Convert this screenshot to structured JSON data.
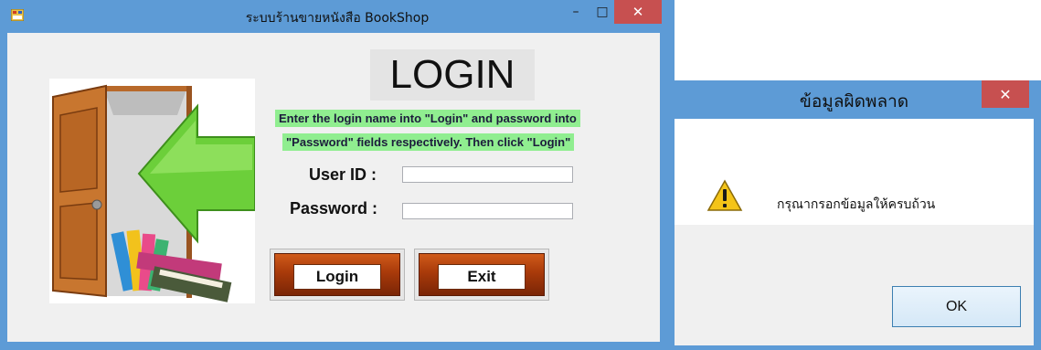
{
  "login_window": {
    "title": "ระบบร้านขายหนังสือ BookShop",
    "controls": {
      "minimize": "–",
      "maximize": "□",
      "close": "✕"
    },
    "heading": "LOGIN",
    "instructions": [
      "Enter the login name into \"Login\" and password into",
      "\"Password\"  fields respectively. Then click \"Login\""
    ],
    "user_id": {
      "label": "User ID :",
      "value": ""
    },
    "password": {
      "label": "Password :",
      "value": ""
    },
    "buttons": {
      "login": "Login",
      "exit": "Exit"
    },
    "colors": {
      "frame": "#5d9bd6",
      "client": "#f0f0f0",
      "instruction_bg": "#90ee90",
      "button_accent": "#a83a0a",
      "close": "#c75050"
    }
  },
  "error_dialog": {
    "title": "ข้อมูลผิดพลาด",
    "close": "✕",
    "icon": "warning-icon",
    "message": "กรุณากรอกข้อมูลให้ครบถ้วน",
    "ok_label": "OK"
  }
}
